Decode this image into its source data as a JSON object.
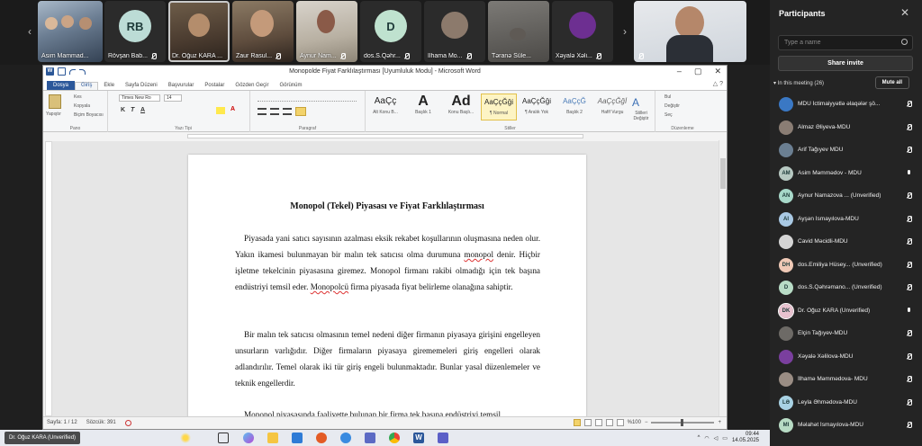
{
  "meeting": {
    "participant_tiles": [
      {
        "name": "Asim Mammad...",
        "initials": "",
        "muted": false
      },
      {
        "name": "Rövşan Bab...",
        "initials": "RB",
        "muted": true
      },
      {
        "name": "Dr. Oğuz KARA ...",
        "initials": "",
        "muted": true
      },
      {
        "name": "Zaur Rasul...",
        "initials": "",
        "muted": true
      },
      {
        "name": "Aynur Nam...",
        "initials": "",
        "muted": true
      },
      {
        "name": "dos.S.Qəhr...",
        "initials": "D",
        "muted": true
      },
      {
        "name": "İlhama Mo...",
        "initials": "",
        "muted": true
      },
      {
        "name": "Təranə Süle...",
        "initials": "",
        "muted": false
      },
      {
        "name": "Xəyalə Xəli...",
        "initials": "",
        "muted": true
      },
      {
        "name": "",
        "initials": "",
        "muted": true
      }
    ],
    "strip_prev_icon": "chevron-left-icon",
    "strip_next_icon": "chevron-right-icon"
  },
  "word": {
    "window_title": "Monopolde Fiyat Farklılaştırması [Uyumluluk Modu] - Microsoft Word",
    "window_buttons": [
      "–",
      "▢",
      "✕"
    ],
    "tabs": [
      "Dosya",
      "Giriş",
      "Ekle",
      "Sayfa Düzeni",
      "Başvurular",
      "Postalar",
      "Gözden Geçir",
      "Görünüm"
    ],
    "active_tab": "Giriş",
    "ribbon": {
      "paste_label": "Yapıştır",
      "clipboard_items": [
        "Kes",
        "Kopyala",
        "Biçim Boyacısı"
      ],
      "font_name": "Times New Ro",
      "font_size": "14",
      "format_buttons": [
        "K",
        "T",
        "A"
      ],
      "groups": [
        "Pano",
        "Yazı Tipi",
        "Paragraf",
        "Stiller",
        "Düzenleme"
      ],
      "styles": [
        {
          "sample": "AaÇç",
          "name": "Alt Konu B..."
        },
        {
          "sample": "A",
          "name": "Başlık 1"
        },
        {
          "sample": "Ad",
          "name": "Konu Başlı..."
        },
        {
          "sample": "AaÇçĞği",
          "name": "¶ Normal"
        },
        {
          "sample": "AaÇçĞği",
          "name": "¶ Aralık Yok"
        },
        {
          "sample": "AaÇçĞ",
          "name": "Başlık 2"
        },
        {
          "sample": "AaÇçĞğİ",
          "name": "Hafif Vurgu"
        }
      ],
      "selected_style": "¶ Normal",
      "change_styles": "Stilleri Değiştir",
      "editing_items": [
        "Bul",
        "Değiştir",
        "Seç"
      ]
    },
    "document": {
      "title": "Monopol (Tekel) Piyasası ve Fiyat Farklılaştırması",
      "paragraph_1": [
        "Piyasada yani satıcı sayısının azalması eksik rekabet koşullarının oluşmasına neden olur. Yakın ikamesi bulunmayan bir malın tek satıcısı olma durumuna ",
        "monopol",
        " denir. Hiçbir işletme tekelcinin piyasasına giremez. Monopol firmanı rakibi olmadığı için tek başına endüstriyi temsil eder. ",
        "Monopolcü",
        " firma piyasada fiyat belirleme olanağına sahiptir."
      ],
      "paragraph_2": "Bir malın tek satıcısı olmasının temel nedeni diğer firmanın piyasaya girişini engelleyen unsurların varlığıdır. Diğer firmaların piyasaya girememeleri giriş engelleri olarak adlandırılır. Temel olarak iki tür giriş engeli bulunmaktadır. Bunlar yasal düzenlemeler ve teknik engellerdir.",
      "paragraph_3": "Monopol piyasasında faaliyette bulunan bir firma tek başına endüstriyi temsil"
    },
    "status": {
      "page": "Sayfa: 1 / 12",
      "words": "Sözcük: 391",
      "zoom": "%100"
    }
  },
  "taskbar": {
    "presenter_name": "Dr. Oğuz KARA (Unverified)",
    "time": "09:44",
    "date": "14.05.2025"
  },
  "participants_panel": {
    "title": "Participants",
    "search_placeholder": "Type a name",
    "share_invite": "Share invite",
    "section_label": "In this meeting (26)",
    "mute_all": "Mute all",
    "people": [
      {
        "name": "MDU İctimaiyyətlə əlaqələr şö...",
        "initials": "",
        "mic": "off",
        "color": "#3a78c4"
      },
      {
        "name": "Almaz Əliyeva-MDU",
        "initials": "",
        "mic": "off",
        "color": "#8a7d74"
      },
      {
        "name": "Arif Tağıyev MDU",
        "initials": "",
        "mic": "off",
        "color": "#6b7f92"
      },
      {
        "name": "Asim Məmmədov - MDU",
        "initials": "AM",
        "mic": "on",
        "color": "#b7c9c2"
      },
      {
        "name": "Aynur Namazova ... (Unverified)",
        "initials": "AN",
        "mic": "off",
        "color": "#a7d8c9"
      },
      {
        "name": "Ayşən İsmayılova-MDU",
        "initials": "AI",
        "mic": "off",
        "color": "#a9c9e4"
      },
      {
        "name": "Cavid Məcidli-MDU",
        "initials": "",
        "mic": "off",
        "color": "#d5d5d5"
      },
      {
        "name": "dos.Emiliya Hüsey... (Unverified)",
        "initials": "DH",
        "mic": "off",
        "color": "#efc9b6"
      },
      {
        "name": "dos.S.Qəhrəmano... (Unverified)",
        "initials": "D",
        "mic": "off",
        "color": "#b8dcc6"
      },
      {
        "name": "Dr. Oğuz KARA (Unverified)",
        "initials": "DK",
        "mic": "on",
        "color": "#e8c2cf"
      },
      {
        "name": "Elçin Tağıyev-MDU",
        "initials": "",
        "mic": "off",
        "color": "#6d6a66"
      },
      {
        "name": "Xəyalə Xəlilova-MDU",
        "initials": "",
        "mic": "off",
        "color": "#7a3f9e"
      },
      {
        "name": "İlhamə Məmmədova- MDU",
        "initials": "",
        "mic": "off",
        "color": "#9a8d84"
      },
      {
        "name": "Leyla Əhmədova-MDU",
        "initials": "LƏ",
        "mic": "off",
        "color": "#a8d2e4"
      },
      {
        "name": "Məlahət İsmayılova-MDU",
        "initials": "MI",
        "mic": "off",
        "color": "#b7dbc4"
      }
    ]
  }
}
